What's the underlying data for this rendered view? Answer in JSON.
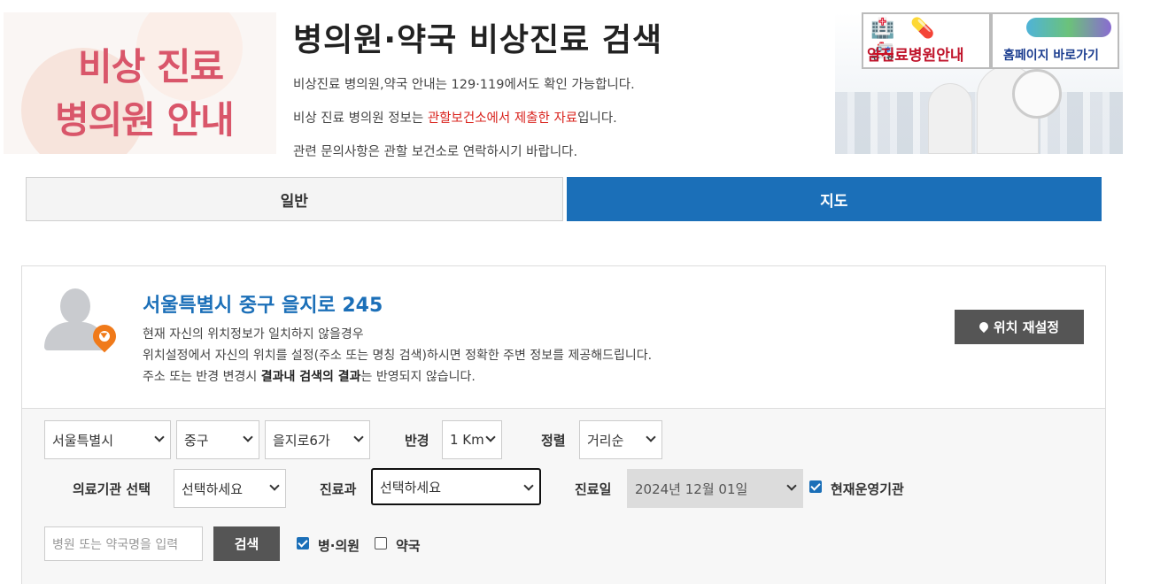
{
  "header": {
    "banner_left_line1": "비상 진료",
    "banner_left_line2": "병의원 안내",
    "title": "병의원·약국 비상진료 검색",
    "desc1": "비상진료 병의원,약국 안내는 129·119에서도 확인 가능합니다.",
    "desc2_prefix": "비상 진료 병의원 정보는 ",
    "desc2_highlight": "관할보건소에서 제출한 자료",
    "desc2_suffix": "입니다.",
    "desc3": "관련 문의사항은 관할 보건소로 연락하시기 바랍니다.",
    "banner_right_btn1": "암진료병원안내",
    "banner_right_btn2": "홈페이지 바로가기"
  },
  "tabs": [
    {
      "label": "일반",
      "active": false
    },
    {
      "label": "지도",
      "active": true
    }
  ],
  "location": {
    "address": "서울특별시 중구 을지로 245",
    "note1": "현재 자신의 위치정보가 일치하지 않을경우",
    "note2": "위치설정에서 자신의 위치를 설정(주소 또는 명칭 검색)하시면 정확한 주변 정보를 제공해드립니다.",
    "note3_prefix": "주소 또는 반경 변경시 ",
    "note3_bold": "결과내 검색의 결과",
    "note3_suffix": "는 반영되지 않습니다.",
    "reset_label": "위치 재설정"
  },
  "filters": {
    "city": "서울특별시",
    "district": "중구",
    "dong": "을지로6가",
    "radius_label": "반경",
    "radius": "1 Km",
    "sort_label": "정렬",
    "sort": "거리순",
    "institution_label": "의료기관 선택",
    "institution": "선택하세요",
    "department_label": "진료과",
    "department": "선택하세요",
    "date_label": "진료일",
    "date": "2024년 12월 01일",
    "operating_label": "현재운영기관",
    "operating_checked": true,
    "search_placeholder": "병원 또는 약국명을 입력",
    "search_button": "검색",
    "hospital_label": "병·의원",
    "hospital_checked": true,
    "pharmacy_label": "약국",
    "pharmacy_checked": false
  },
  "colors": {
    "accent": "#1b6fb8",
    "highlight_red": "#d9231d",
    "banner_pink": "#d9566a",
    "button_gray": "#555555"
  }
}
